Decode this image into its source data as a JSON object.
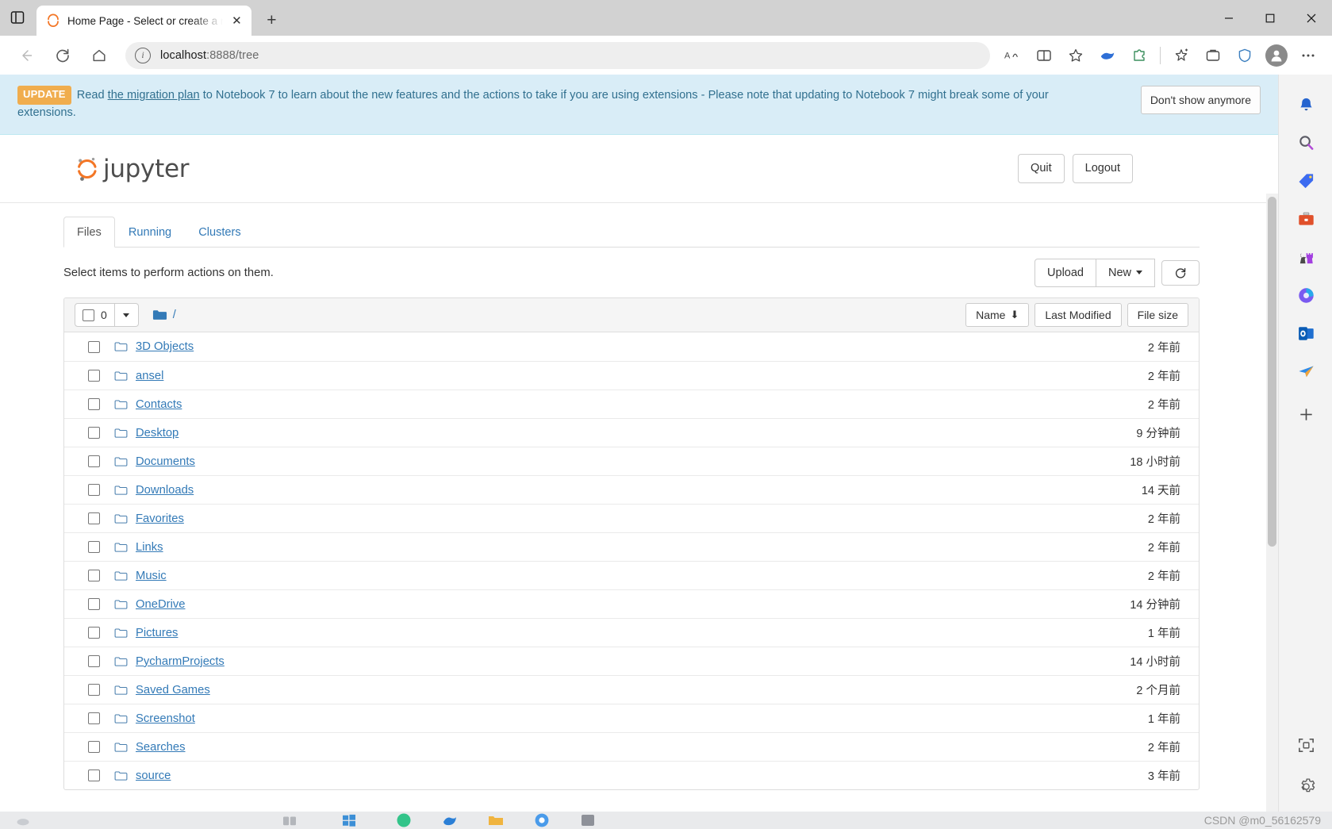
{
  "browser": {
    "tab": {
      "title": "Home Page - Select or create a n",
      "favicon": "jupyter-icon",
      "close_label": "✕"
    },
    "new_tab_label": "+",
    "nav": {
      "back": "back-arrow-icon",
      "reload": "reload-icon",
      "home": "home-icon"
    },
    "address": {
      "host": "localhost",
      "rest": ":8888/tree",
      "info_glyph": "i"
    },
    "window_controls": {
      "minimize": "─",
      "maximize": "☐",
      "close": "✕"
    }
  },
  "notification": {
    "badge": "UPDATE",
    "text_before_link": "Read ",
    "link_text": "the migration plan",
    "text_after_link": " to Notebook 7 to learn about the new features and the actions to take if you are using extensions - Please note that updating to Notebook 7 might break some of your extensions.",
    "dismiss_label": "Don't show anymore",
    "bg_color": "#d9edf7",
    "text_color": "#31708f",
    "badge_color": "#f0ad4e"
  },
  "jupyter": {
    "brand": "jupyter",
    "quit_label": "Quit",
    "logout_label": "Logout",
    "tabs": [
      {
        "label": "Files",
        "active": true
      },
      {
        "label": "Running",
        "active": false
      },
      {
        "label": "Clusters",
        "active": false
      }
    ],
    "select_hint": "Select items to perform actions on them.",
    "upload_label": "Upload",
    "new_label": "New",
    "refresh_icon": "refresh-icon",
    "list_header": {
      "selected_count": "0",
      "path": "/",
      "sort_name": "Name",
      "sort_name_arrow": "⬇",
      "sort_modified": "Last Modified",
      "sort_filesize": "File size"
    },
    "files": [
      {
        "name": "3D Objects",
        "modified": "2 年前"
      },
      {
        "name": "ansel",
        "modified": "2 年前"
      },
      {
        "name": "Contacts",
        "modified": "2 年前"
      },
      {
        "name": "Desktop",
        "modified": "9 分钟前"
      },
      {
        "name": "Documents",
        "modified": "18 小时前"
      },
      {
        "name": "Downloads",
        "modified": "14 天前"
      },
      {
        "name": "Favorites",
        "modified": "2 年前"
      },
      {
        "name": "Links",
        "modified": "2 年前"
      },
      {
        "name": "Music",
        "modified": "2 年前"
      },
      {
        "name": "OneDrive",
        "modified": "14 分钟前"
      },
      {
        "name": "Pictures",
        "modified": "1 年前"
      },
      {
        "name": "PycharmProjects",
        "modified": "14 小时前"
      },
      {
        "name": "Saved Games",
        "modified": "2 个月前"
      },
      {
        "name": "Screenshot",
        "modified": "1 年前"
      },
      {
        "name": "Searches",
        "modified": "2 年前"
      },
      {
        "name": "source",
        "modified": "3 年前"
      }
    ]
  },
  "edgebar": {
    "items": [
      {
        "name": "notifications-bell-icon"
      },
      {
        "name": "search-magnifier-icon"
      },
      {
        "name": "price-tag-icon"
      },
      {
        "name": "briefcase-icon"
      },
      {
        "name": "games-chess-icon"
      },
      {
        "name": "microsoft-365-icon"
      },
      {
        "name": "outlook-icon"
      },
      {
        "name": "paper-plane-icon"
      },
      {
        "name": "add-plus-icon"
      }
    ],
    "bottom_items": [
      {
        "name": "screenshot-capture-icon"
      },
      {
        "name": "settings-gear-icon"
      }
    ]
  },
  "watermark": "CSDN @m0_56162579",
  "colors": {
    "link": "#337ab7",
    "banner_bg": "#d9edf7",
    "accent_orange": "#f37626"
  }
}
